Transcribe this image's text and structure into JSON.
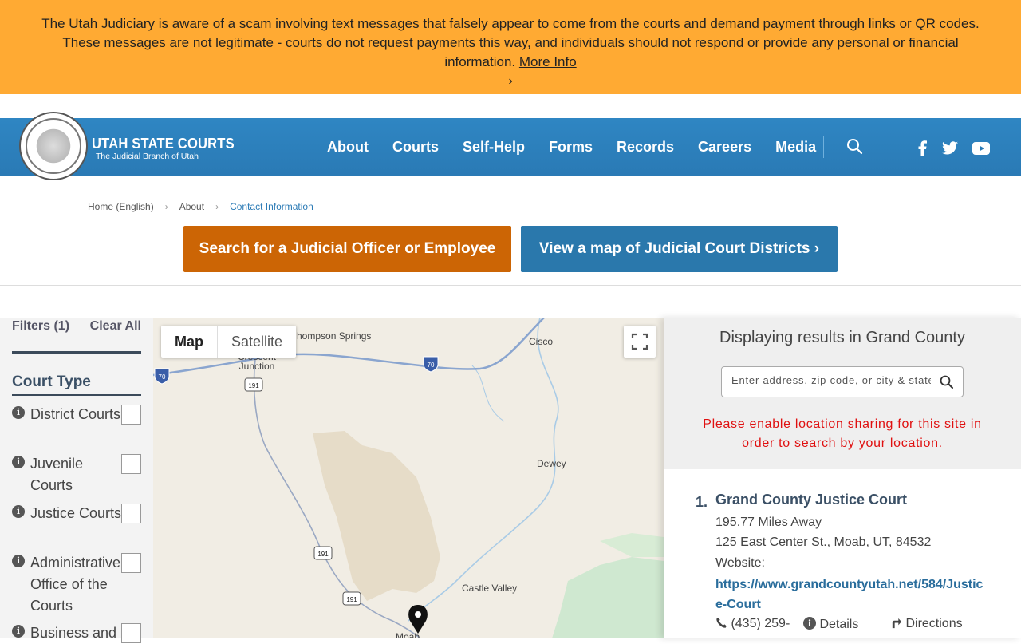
{
  "alert": {
    "text": "The Utah Judiciary is aware of a scam involving text messages that falsely appear to come from the courts and demand payment through links or QR codes. These messages are not legitimate - courts do not request payments this way, and individuals should not respond or provide any personal or financial information.",
    "link_label": "More Info",
    "chevron": "›"
  },
  "header": {
    "brand_title": "UTAH STATE COURTS",
    "brand_subtitle": "The Judicial Branch of Utah",
    "nav": [
      "About",
      "Courts",
      "Self-Help",
      "Forms",
      "Records",
      "Careers",
      "Media"
    ],
    "social": [
      "facebook-icon",
      "twitter-icon",
      "youtube-icon"
    ]
  },
  "breadcrumb": [
    "Home (English)",
    "About",
    "Contact Information"
  ],
  "buttons": {
    "search_officer": "Search for a Judicial Officer or Employee",
    "view_map": "View a map of Judicial Court Districts ›"
  },
  "filters": {
    "label": "Filters (1)",
    "clear_all": "Clear All",
    "court_type_title": "Court Type",
    "items": [
      {
        "label": "District Courts",
        "checked": false
      },
      {
        "label": "Juvenile Courts",
        "checked": false
      },
      {
        "label": "Justice Courts",
        "checked": false
      },
      {
        "label": "Administrative Office of the Courts",
        "checked": false
      },
      {
        "label": "Business and",
        "checked": false
      }
    ]
  },
  "map": {
    "tab_map": "Map",
    "tab_satellite": "Satellite",
    "labels": [
      "hompson Springs",
      "Crescent Junction",
      "Cisco",
      "Dewey",
      "Castle Valley",
      "Moab"
    ],
    "shields": [
      "70",
      "70",
      "191",
      "191",
      "191"
    ]
  },
  "results": {
    "heading": "Displaying results in Grand County",
    "search_placeholder": "Enter address, zip code, or city & state",
    "location_warning": "Please enable location sharing for this site in order to search by your location.",
    "items": [
      {
        "number": "1.",
        "name": "Grand County Justice Court",
        "distance": "195.77 Miles Away",
        "address": "125 East Center St., Moab, UT, 84532",
        "website_label": "Website:",
        "website": "https://www.grandcountyutah.net/584/Justice-Court",
        "phone": "(435) 259-",
        "details": "Details",
        "directions": "Directions"
      }
    ]
  },
  "colors": {
    "alert_bg": "#ffaa33",
    "header_bg": "#2a7ab5",
    "orange_button": "#cc6505",
    "blue_button": "#2a78ac",
    "warning_text": "#e01010"
  }
}
